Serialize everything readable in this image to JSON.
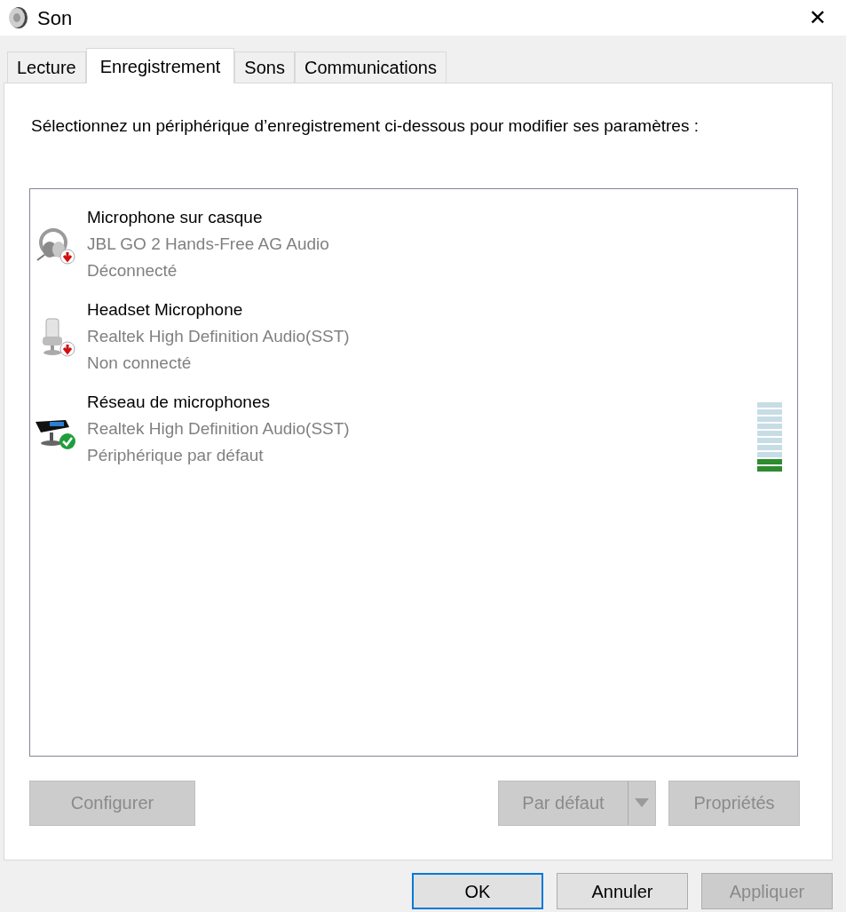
{
  "window": {
    "title": "Son",
    "close": "✕"
  },
  "tabs": [
    {
      "label": "Lecture",
      "selected": false
    },
    {
      "label": "Enregistrement",
      "selected": true
    },
    {
      "label": "Sons",
      "selected": false
    },
    {
      "label": "Communications",
      "selected": false
    }
  ],
  "instruction": "Sélectionnez un périphérique d’enregistrement ci-dessous pour modifier ses paramètres :",
  "devices": [
    {
      "kind": "headset",
      "is_default": false,
      "name": "Microphone sur casque",
      "driver": "JBL GO 2 Hands-Free AG Audio",
      "status": "Déconnecté"
    },
    {
      "kind": "microphone",
      "is_default": false,
      "name": "Headset Microphone",
      "driver": "Realtek High Definition Audio(SST)",
      "status": "Non connecté"
    },
    {
      "kind": "array",
      "is_default": true,
      "name": "Réseau de microphones",
      "driver": "Realtek High Definition Audio(SST)",
      "status": "Périphérique par défaut",
      "level": 0.2
    }
  ],
  "panel_buttons": {
    "configure": {
      "label": "Configurer",
      "disabled": true
    },
    "set_default": {
      "label": "Par défaut",
      "disabled": true
    },
    "properties": {
      "label": "Propriétés",
      "disabled": true
    }
  },
  "dialog_buttons": [
    {
      "label": "OK",
      "focused": true,
      "disabled": false
    },
    {
      "label": "Annuler",
      "focused": false,
      "disabled": false
    },
    {
      "label": "Appliquer",
      "focused": false,
      "disabled": true
    }
  ]
}
